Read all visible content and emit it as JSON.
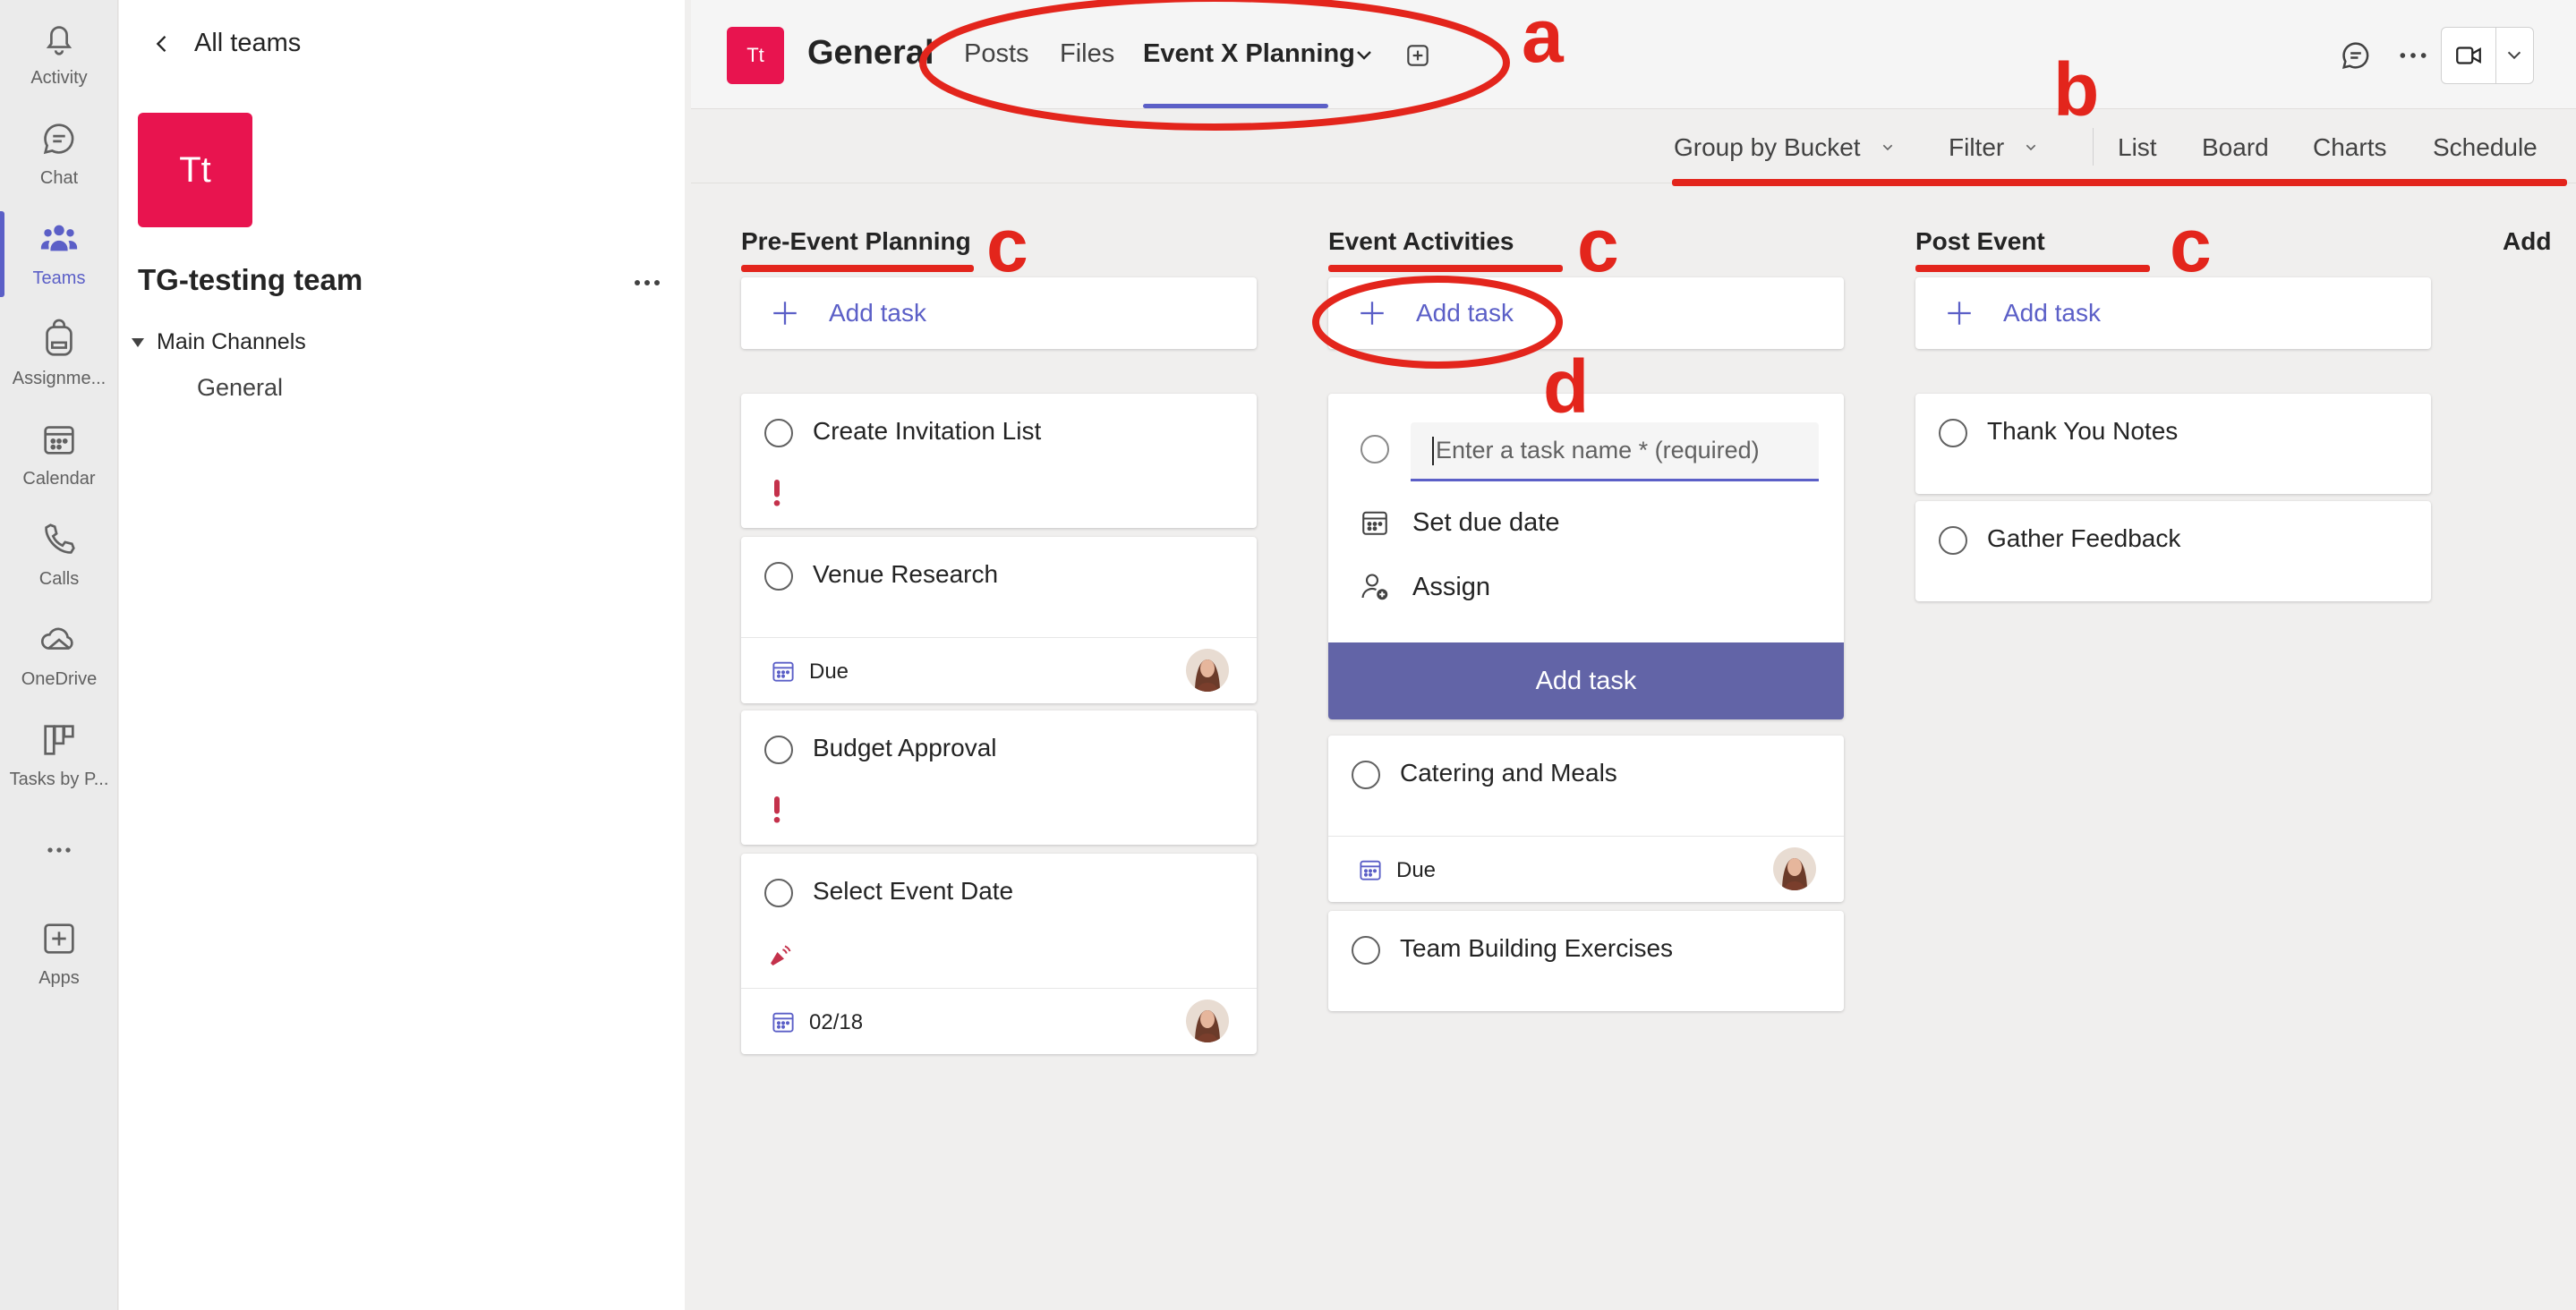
{
  "rail": {
    "items": [
      {
        "label": "Activity",
        "icon": "bell-icon"
      },
      {
        "label": "Chat",
        "icon": "chat-icon"
      },
      {
        "label": "Teams",
        "icon": "teams-icon"
      },
      {
        "label": "Assignme...",
        "icon": "backpack-icon"
      },
      {
        "label": "Calendar",
        "icon": "calendar-icon"
      },
      {
        "label": "Calls",
        "icon": "phone-icon"
      },
      {
        "label": "OneDrive",
        "icon": "cloud-icon"
      },
      {
        "label": "Tasks by P...",
        "icon": "tasks-icon"
      },
      {
        "label": "",
        "icon": "more-icon"
      },
      {
        "label": "Apps",
        "icon": "add-app-icon"
      }
    ]
  },
  "team_panel": {
    "back_label": "All teams",
    "team_initials": "Tt",
    "team_name": "TG-testing team",
    "channels_header": "Main Channels",
    "channel": "General"
  },
  "header": {
    "channel_initials": "Tt",
    "channel_name": "General",
    "tabs": [
      "Posts",
      "Files",
      "Event X Planning"
    ]
  },
  "toolbar": {
    "group_by": "Group by Bucket",
    "filter": "Filter",
    "views": [
      "List",
      "Board",
      "Charts",
      "Schedule"
    ]
  },
  "board": {
    "add_task_label": "Add task",
    "buckets": [
      {
        "name": "Pre-Event Planning",
        "tasks": [
          {
            "title": "Create Invitation List",
            "priority": "important"
          },
          {
            "title": "Venue Research",
            "due": "Due"
          },
          {
            "title": "Budget Approval",
            "priority": "important"
          },
          {
            "title": "Select Event Date",
            "priority": "urgent",
            "due": "02/18"
          }
        ]
      },
      {
        "name": "Event Activities",
        "new_task": {
          "placeholder": "Enter a task name * (required)",
          "set_due": "Set due date",
          "assign": "Assign",
          "submit": "Add task"
        },
        "tasks": [
          {
            "title": "Catering and Meals",
            "due": "Due"
          },
          {
            "title": "Team Building Exercises"
          }
        ]
      },
      {
        "name": "Post Event",
        "tasks": [
          {
            "title": "Thank You Notes"
          },
          {
            "title": "Gather Feedback"
          }
        ]
      },
      {
        "name": "Add"
      }
    ]
  },
  "annotations": {
    "a": "a",
    "b": "b",
    "c": "c",
    "d": "d",
    "color": "#e3251c"
  },
  "colors": {
    "accent": "#5b5fc7",
    "button": "#6264a7",
    "team_avatar": "#e8144f",
    "priority": "#c4314b"
  }
}
